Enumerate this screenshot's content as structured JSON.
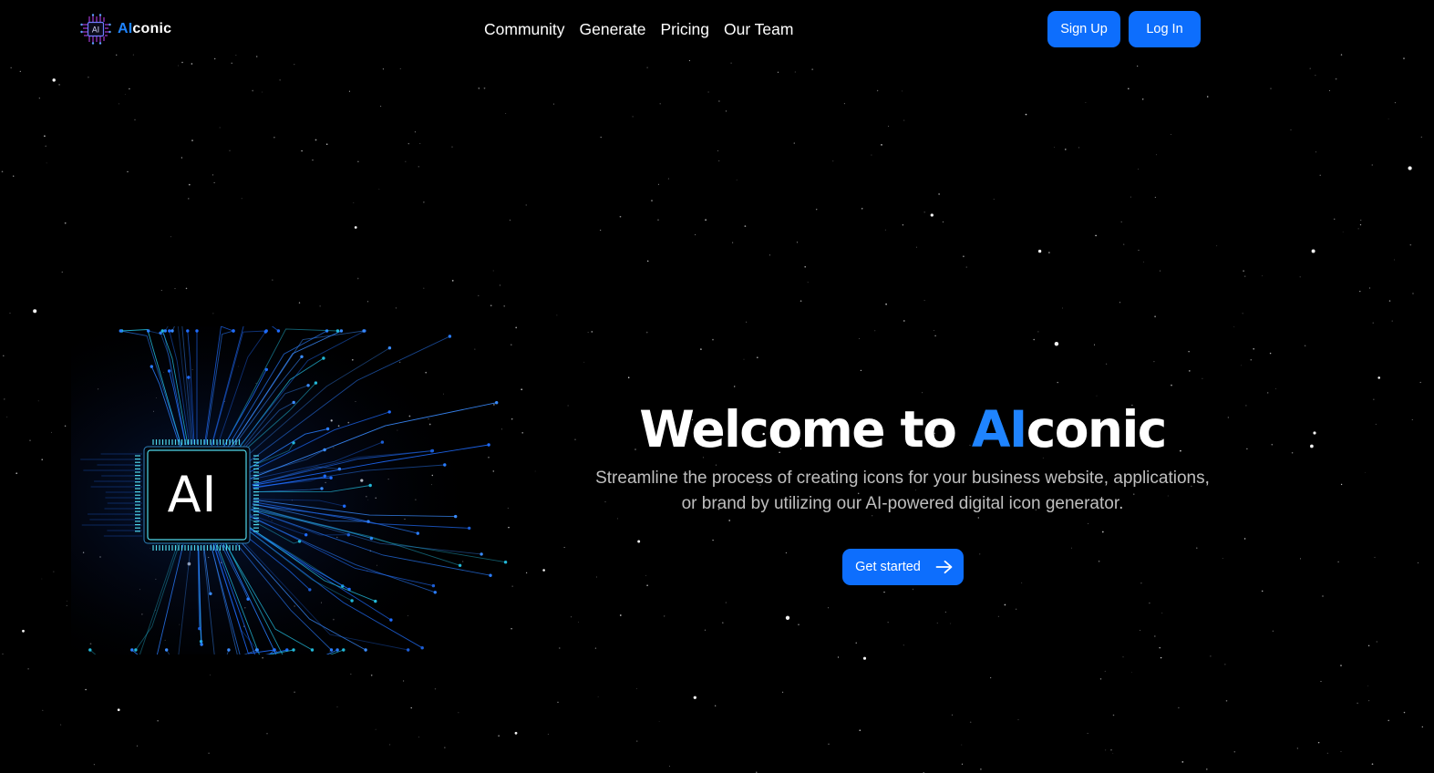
{
  "brand": {
    "name_accent": "AI",
    "name_rest": "conic",
    "logo_chip_text": "AI",
    "accent_color": "#1f84ff"
  },
  "nav": {
    "items": [
      {
        "label": "Community"
      },
      {
        "label": "Generate"
      },
      {
        "label": "Pricing"
      },
      {
        "label": "Our Team"
      }
    ]
  },
  "auth": {
    "signup_label": "Sign Up",
    "login_label": "Log In",
    "button_color": "#0d6efd"
  },
  "hero": {
    "title_prefix": "Welcome to ",
    "title_accent": "AI",
    "title_rest": "conic",
    "subtitle": "Streamline the process of creating icons for your business website, applications, or brand by utilizing our AI-powered digital icon generator.",
    "cta_label": "Get started",
    "cta_icon": "arrow-right-icon"
  },
  "illustration": {
    "chip_text": "AI",
    "trace_color": "#1f6cff"
  },
  "background": {
    "color": "#000000"
  }
}
